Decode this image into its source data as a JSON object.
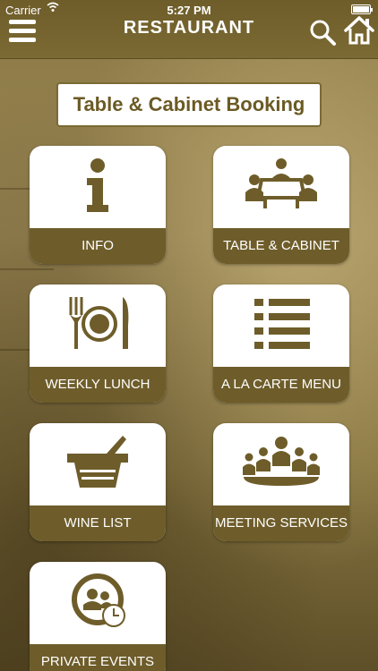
{
  "status": {
    "carrier": "Carrier",
    "time": "5:27 PM"
  },
  "header": {
    "title": "RESTAURANT"
  },
  "banner": {
    "title": "Table & Cabinet Booking"
  },
  "tiles": [
    {
      "label": "INFO",
      "icon": "info-icon"
    },
    {
      "label": "TABLE & CABINET",
      "icon": "meeting-table-icon"
    },
    {
      "label": "WEEKLY LUNCH",
      "icon": "plate-cutlery-icon"
    },
    {
      "label": "A LA CARTE MENU",
      "icon": "list-icon"
    },
    {
      "label": "WINE LIST",
      "icon": "wine-bucket-icon"
    },
    {
      "label": "MEETING SERVICES",
      "icon": "conference-icon"
    },
    {
      "label": "PRIVATE EVENTS",
      "icon": "people-clock-icon"
    }
  ],
  "colors": {
    "brand": "#6e5d2a",
    "tile_background": "#ffffff",
    "text_on_brand": "#ffffff"
  }
}
